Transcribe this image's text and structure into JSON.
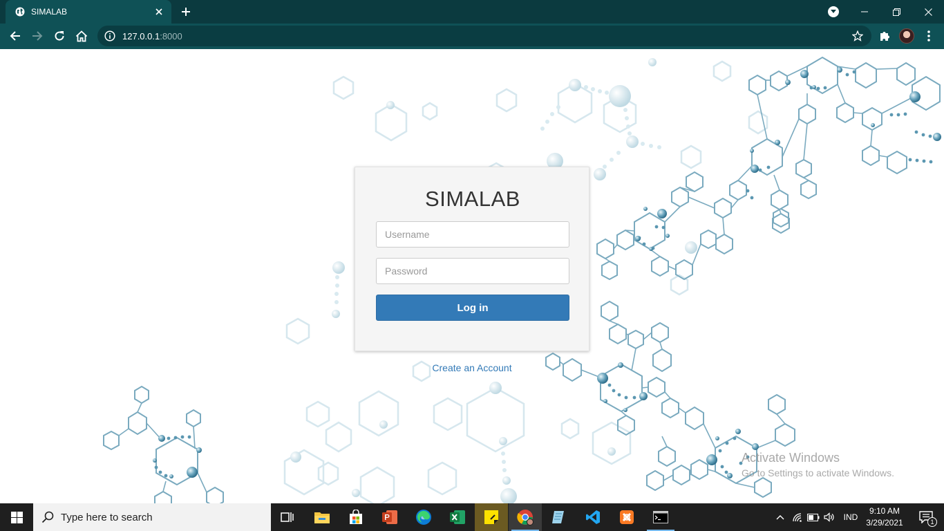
{
  "browser": {
    "tab_title": "SIMALAB",
    "url_host": "127.0.0.1",
    "url_port": ":8000"
  },
  "login": {
    "title": "SIMALAB",
    "username_placeholder": "Username",
    "password_placeholder": "Password",
    "login_button": "Log in",
    "create_account": "Create an Account"
  },
  "watermark": {
    "line1": "Activate Windows",
    "line2": "Go to Settings to activate Windows."
  },
  "taskbar": {
    "search_placeholder": "Type here to search",
    "apps": [
      "task-view",
      "file-explorer",
      "microsoft-store",
      "powerpoint",
      "edge",
      "excel",
      "sticky-notes",
      "chrome",
      "notepad",
      "vscode",
      "xampp",
      "command-prompt"
    ],
    "language": "IND",
    "time": "9:10 AM",
    "date": "3/29/2021",
    "notification_count": "1"
  },
  "colors": {
    "chrome_dark": "#0b3a3f",
    "chrome_toolbar": "#0f5156",
    "primary_button": "#337ab7",
    "molecule": "#7aaabf"
  }
}
